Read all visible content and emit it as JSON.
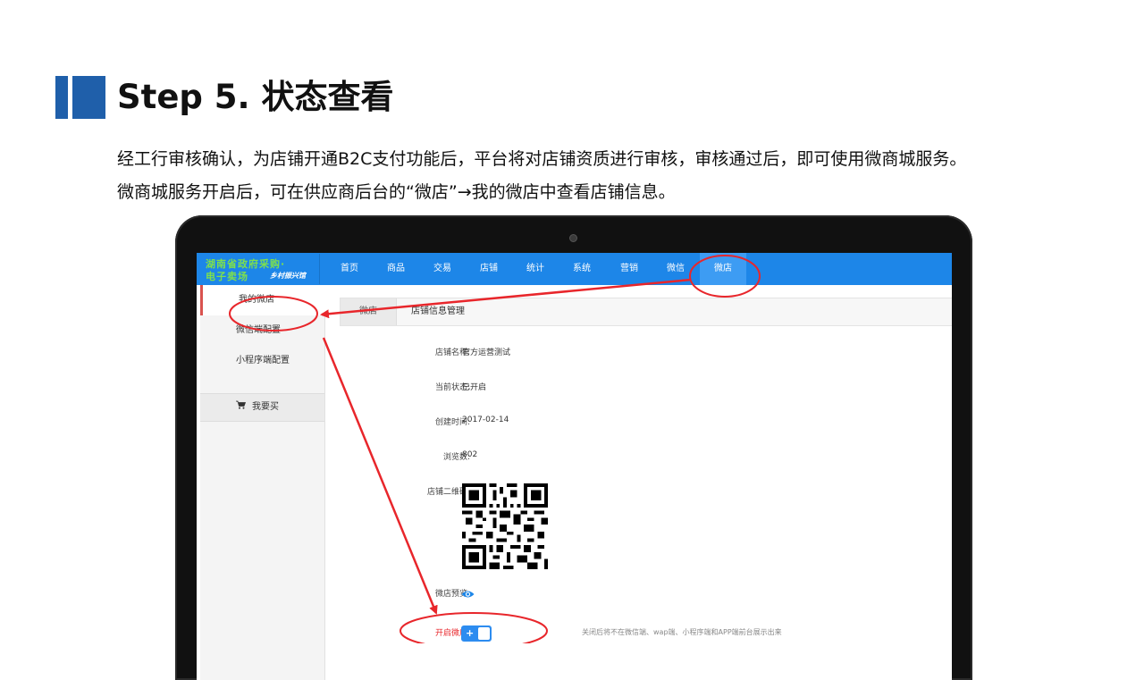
{
  "slide": {
    "title": "Step 5. 状态查看",
    "intro_line1": "经工行审核确认，为店铺开通B2C支付功能后，平台将对店铺资质进行审核，审核通过后，即可使用微商城服务。",
    "intro_line2": "微商城服务开启后，可在供应商后台的“微店”→我的微店中查看店铺信息。"
  },
  "app": {
    "logo": {
      "line1": "湖南省政府采购·",
      "line2": "电子卖场",
      "line3": "乡村振兴馆"
    },
    "nav": [
      "首页",
      "商品",
      "交易",
      "店铺",
      "统计",
      "系统",
      "营销",
      "微信",
      "微店"
    ],
    "nav_active": "微店",
    "sidebar": {
      "items": [
        "我的微店",
        "微信端配置",
        "小程序端配置"
      ],
      "active": "我的微店",
      "buy_label": "我要买"
    },
    "tabs": {
      "section": "微店",
      "current": "店铺信息管理"
    },
    "store": {
      "name_label": "店铺名称:",
      "name_value": "官方运营测试",
      "status_label": "当前状态:",
      "status_value": "已开启",
      "created_label": "创建时间:",
      "created_value": "2017-02-14",
      "views_label": "浏览数:",
      "views_value": "802",
      "qr_label": "店铺二维码:",
      "preview_label": "微店预览:",
      "open_label": "开启微店:",
      "open_note": "关闭后将不在微信端、wap端、小程序端和APP端前台展示出来",
      "open_state": true
    }
  },
  "colors": {
    "nav_bg": "#1d86e8",
    "title_mark": "#1f5faa",
    "annotation": "#e8262b",
    "logo_text": "#7ee04d"
  }
}
